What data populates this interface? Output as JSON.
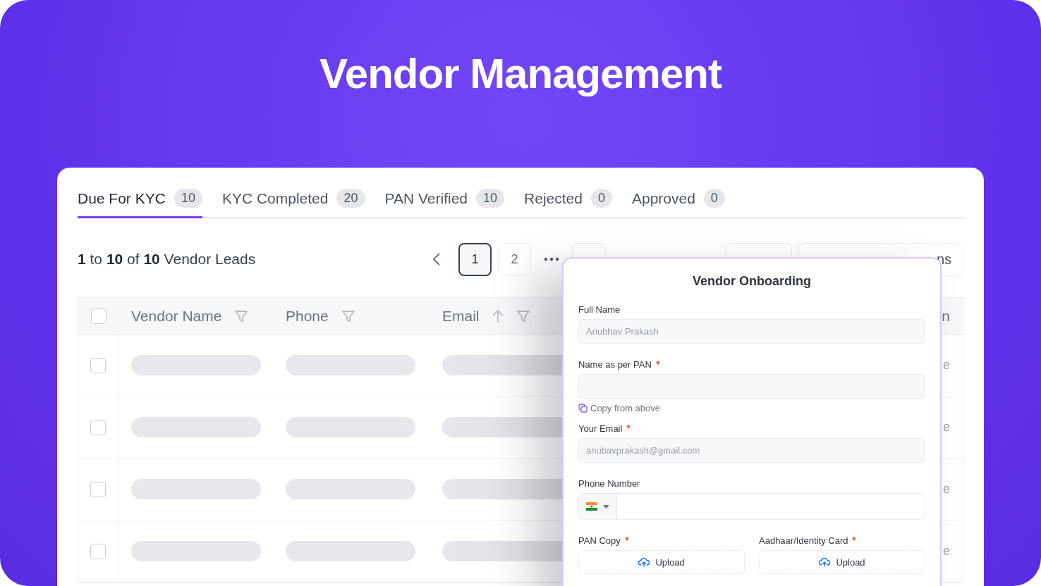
{
  "hero": {
    "title": "Vendor Management"
  },
  "tabs": [
    {
      "label": "Due For KYC",
      "count": "10",
      "selected": true
    },
    {
      "label": "KYC Completed",
      "count": "20",
      "selected": false
    },
    {
      "label": "PAN Verified",
      "count": "10",
      "selected": false
    },
    {
      "label": "Rejected",
      "count": "0",
      "selected": false
    },
    {
      "label": "Approved",
      "count": "0",
      "selected": false
    }
  ],
  "summary": {
    "from": "1",
    "to": "10",
    "total": "10",
    "parts": [
      "to",
      "of",
      "Vendor Leads"
    ]
  },
  "pagination": {
    "pages": [
      {
        "label": "1",
        "selected": true
      },
      {
        "label": "2",
        "selected": false
      }
    ]
  },
  "columns_button": {
    "label": "ns"
  },
  "table": {
    "select_all": {
      "checked": false
    },
    "columns": [
      {
        "label": "Vendor Name",
        "sortable": false
      },
      {
        "label": "Phone",
        "sortable": false
      },
      {
        "label": "Email",
        "sortable": true
      },
      {
        "label": "n",
        "sortable": false
      }
    ],
    "rows": [
      {
        "checked": false,
        "column_4": "e"
      },
      {
        "checked": false,
        "column_4": "e"
      },
      {
        "checked": false,
        "column_4": "e"
      },
      {
        "checked": false,
        "column_4": "e"
      }
    ]
  },
  "modal": {
    "title": "Vendor Onboarding",
    "fields": [
      {
        "kind": "text",
        "label": "Full Name",
        "required": false,
        "value": "Anubhav Prakash"
      },
      {
        "kind": "text",
        "label": "Name as per PAN",
        "required": true,
        "helper": "Copy from above"
      },
      {
        "kind": "text",
        "label": "Your Email",
        "required": true,
        "value": "anubavprakash@gmail.com"
      },
      {
        "kind": "phone",
        "label": "Phone Number",
        "required": false
      }
    ],
    "uploads": [
      {
        "label": "PAN Copy",
        "required": true,
        "button": "Upload"
      },
      {
        "label": "Aadhaar/Identity Card",
        "required": true,
        "button": "Upload"
      }
    ]
  }
}
